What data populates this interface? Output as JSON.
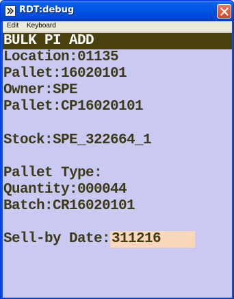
{
  "window": {
    "title": "RDT:debug",
    "colors": {
      "titlebar": "#0054e3",
      "screen": "#c9c9f2",
      "text": "#3d3a17",
      "header": "#4a4110",
      "input": "#f8d8b8"
    }
  },
  "menu": {
    "items": [
      {
        "label": "Edit"
      },
      {
        "label": "Keyboard"
      }
    ]
  },
  "screen": {
    "header": "BULK PI ADD",
    "fields": {
      "location": "Location:01135",
      "pallet": "Pallet:16020101",
      "owner": "Owner:SPE",
      "pallet2": "Pallet:CP16020101",
      "stock": "Stock:SPE_322664_1",
      "pallet_type": "Pallet Type:",
      "quantity": "Quantity:000044",
      "batch": "Batch:CR16020101"
    },
    "sell_by": {
      "label": "Sell-by Date:",
      "value": "311216"
    }
  }
}
